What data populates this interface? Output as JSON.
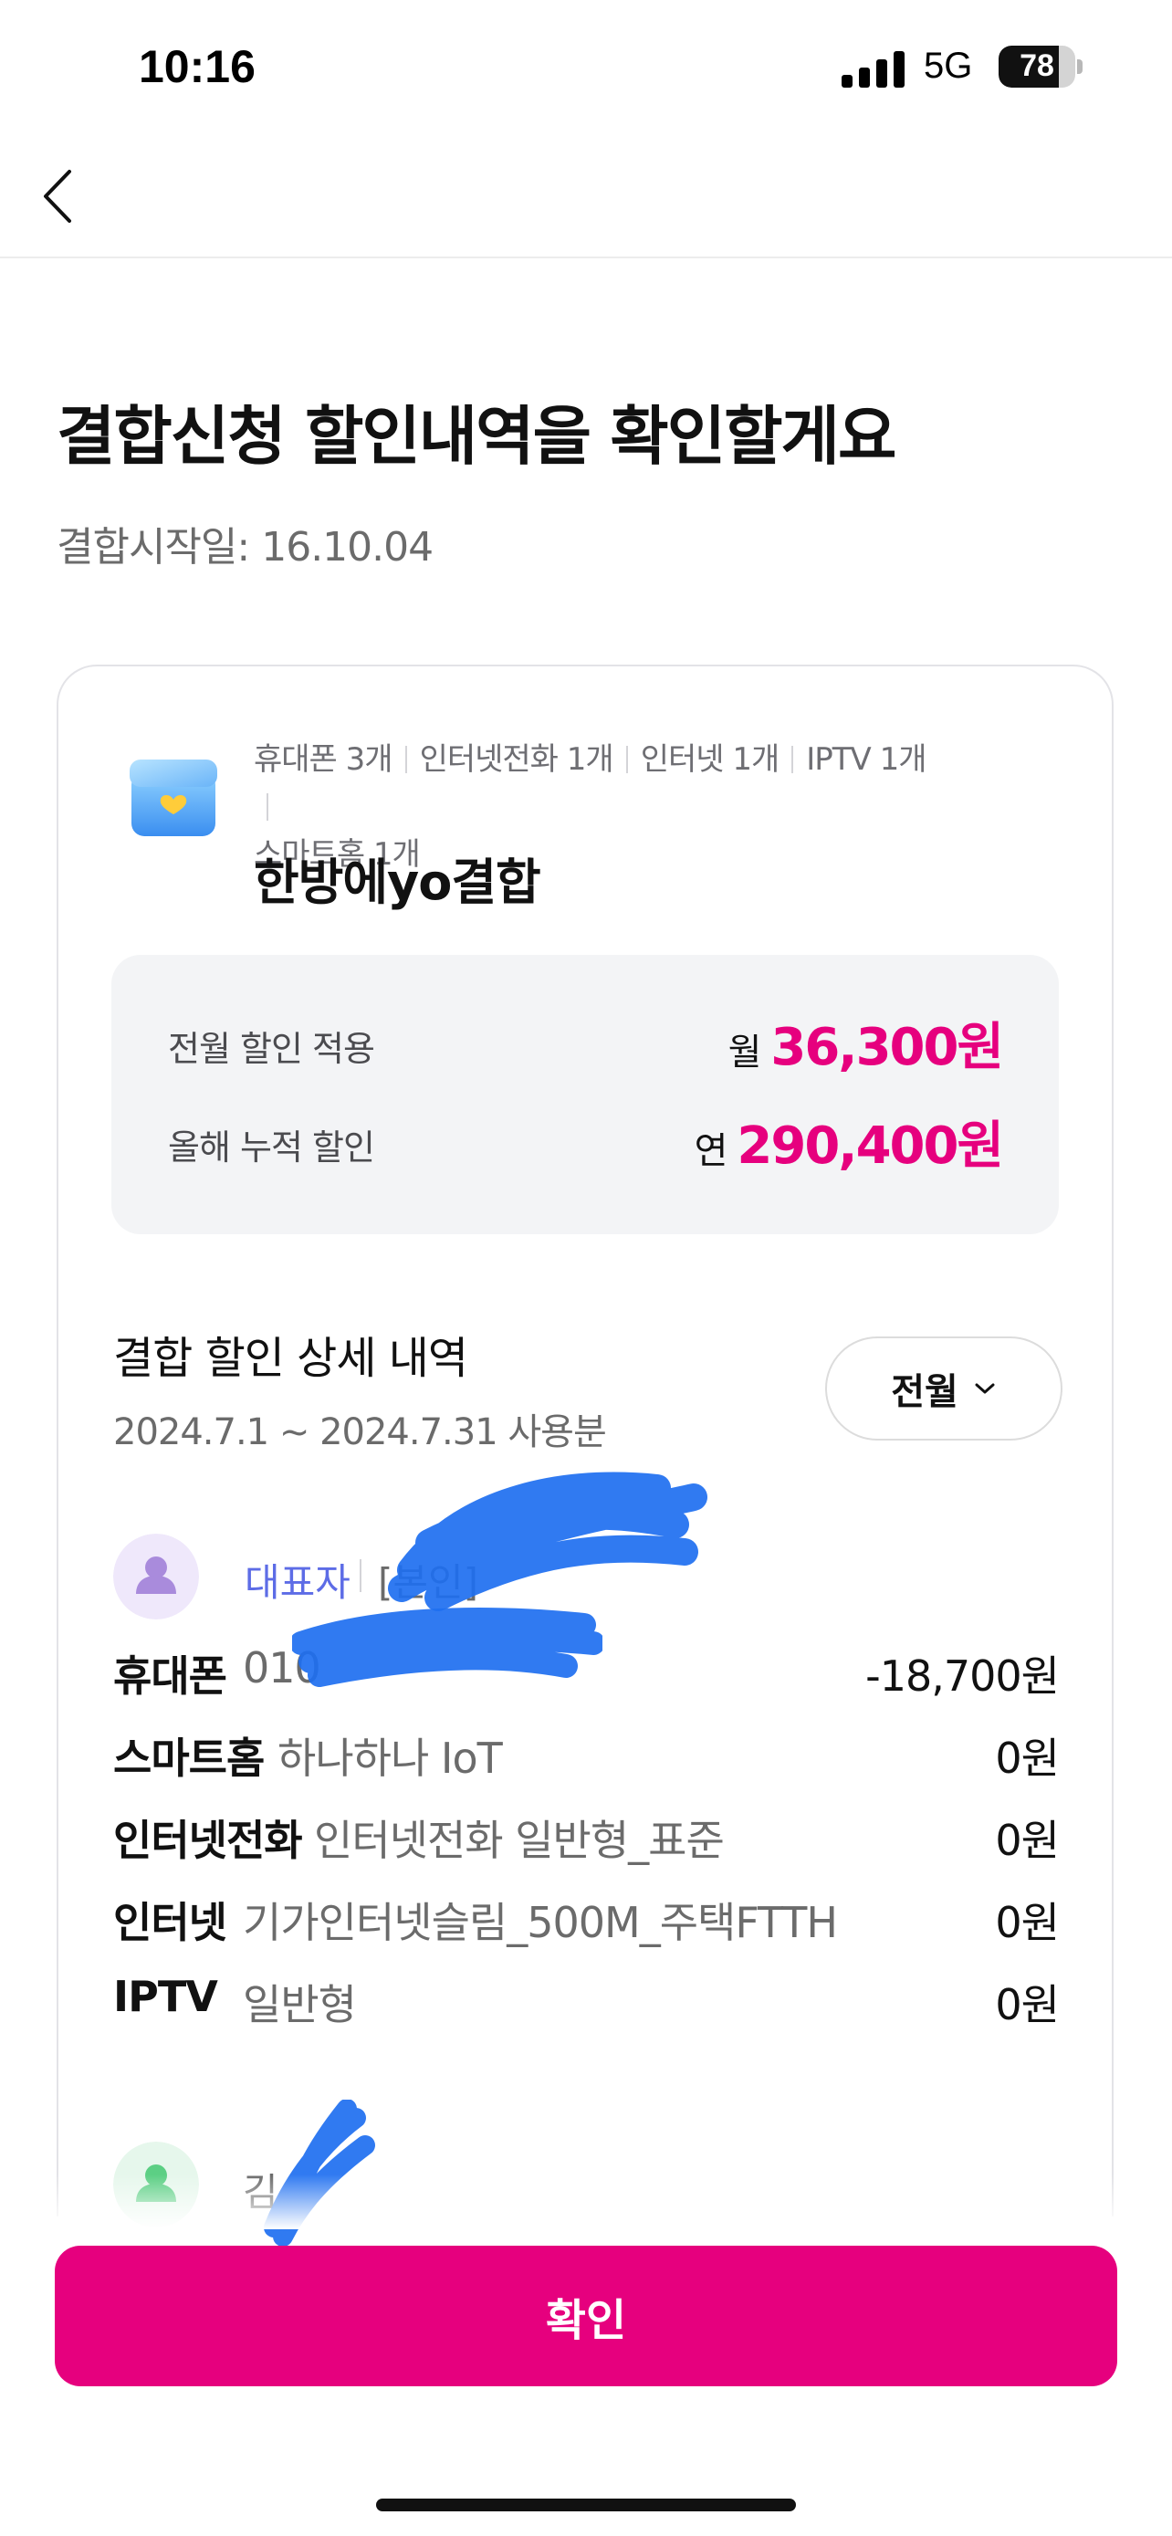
{
  "status_bar": {
    "time": "10:16",
    "network": "5G",
    "battery": "78",
    "battery_level": 0.78
  },
  "nav": {
    "back_icon": "chevron-left-icon"
  },
  "header": {
    "title": "결합신청 할인내역을 확인할게요",
    "start_date": "결합시작일: 16.10.04"
  },
  "card": {
    "products": [
      "휴대폰 3개",
      "인터넷전화 1개",
      "인터넷 1개",
      "IPTV 1개",
      "스마트홈 1개"
    ],
    "plan_name": "한방에yo결합",
    "summary": {
      "monthly_label": "전월 할인 적용",
      "monthly_prefix": "월",
      "monthly_amount": "36,300원",
      "yearly_label": "올해 누적 할인",
      "yearly_prefix": "연",
      "yearly_amount": "290,400원"
    },
    "detail": {
      "title": "결합 할인 상세 내역",
      "period": "2024.7.1 ~ 2024.7.31 사용분",
      "month_button": "전월"
    },
    "members": [
      {
        "role": "대표자",
        "relation": "[본인]",
        "rows": [
          {
            "label": "휴대폰",
            "plan": "010",
            "amount": "-18,700원"
          },
          {
            "label": "스마트홈",
            "plan": "하나하나 IoT",
            "amount": "0원"
          },
          {
            "label": "인터넷전화",
            "plan": "인터넷전화 일반형_표준",
            "amount": "0원"
          },
          {
            "label": "인터넷",
            "plan": "기가인터넷슬림_500M_주택FTTH",
            "amount": "0원"
          },
          {
            "label": "IPTV",
            "plan": "일반형",
            "amount": "0원"
          }
        ]
      },
      {
        "name": "김"
      }
    ]
  },
  "confirm_button": "확인",
  "colors": {
    "accent": "#e6007e",
    "role": "#5d6ce6"
  }
}
